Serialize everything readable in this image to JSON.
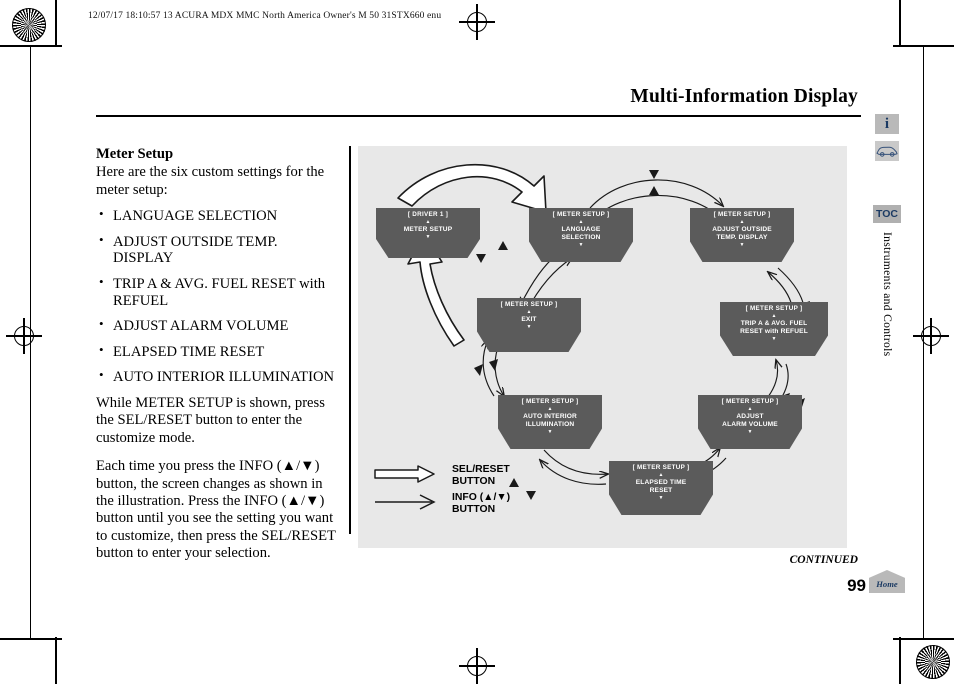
{
  "header": {
    "print_info": "12/07/17 18:10:57    13 ACURA MDX MMC North America Owner's M 50 31STX660 enu"
  },
  "page": {
    "title": "Multi-Information Display",
    "continued_label": "CONTINUED",
    "number": "99"
  },
  "sidebar": {
    "info_icon": "i",
    "car_icon": "car-side-icon",
    "toc_label": "TOC",
    "section_tab": "Instruments and Controls",
    "home_label": "Home"
  },
  "content": {
    "heading": "Meter Setup",
    "intro": "Here are the six custom settings for the meter setup:",
    "bullets": [
      "LANGUAGE SELECTION",
      "ADJUST OUTSIDE TEMP. DISPLAY",
      "TRIP A & AVG. FUEL RESET with REFUEL",
      "ADJUST ALARM VOLUME",
      "ELAPSED TIME RESET",
      "AUTO INTERIOR ILLUMINATION"
    ],
    "para1": "While METER SETUP is shown, press the SEL/RESET button to enter the customize mode.",
    "para2": "Each time you press the INFO (▲/▼) button, the screen changes as shown in the illustration. Press the INFO (▲/▼) button until you see the setting you want to customize, then press the SEL/RESET button to enter your selection."
  },
  "diagram": {
    "background_color": "#e8e8e8",
    "box_color": "#5b5b5b",
    "boxes": [
      {
        "header": "[ DRIVER 1 ]",
        "label": "METER SETUP",
        "up": "▲",
        "down": "▼"
      },
      {
        "header": "[ METER SETUP ]",
        "label": "LANGUAGE\nSELECTION",
        "up": "▲",
        "down": "▼"
      },
      {
        "header": "[ METER SETUP ]",
        "label": "ADJUST OUTSIDE\nTEMP. DISPLAY",
        "up": "▲",
        "down": "▼"
      },
      {
        "header": "[ METER SETUP ]",
        "label": "TRIP A & AVG. FUEL\nRESET with REFUEL",
        "up": "▲",
        "down": "▼"
      },
      {
        "header": "[ METER SETUP ]",
        "label": "ADJUST\nALARM VOLUME",
        "up": "▲",
        "down": "▼"
      },
      {
        "header": "[ METER SETUP ]",
        "label": "ELAPSED TIME\nRESET",
        "up": "▲",
        "down": "▼"
      },
      {
        "header": "[ METER SETUP ]",
        "label": "AUTO INTERIOR\nILLUMINATION",
        "up": "▲",
        "down": "▼"
      },
      {
        "header": "[ METER SETUP ]",
        "label": "EXIT",
        "up": "▲",
        "down": "▼"
      }
    ],
    "legend": [
      {
        "arrow": "hollow-arrow",
        "line1": "SEL/RESET",
        "line2": "BUTTON"
      },
      {
        "arrow": "thin-arrow",
        "line1": "INFO (▲/▼)",
        "line2": "BUTTON"
      }
    ]
  }
}
